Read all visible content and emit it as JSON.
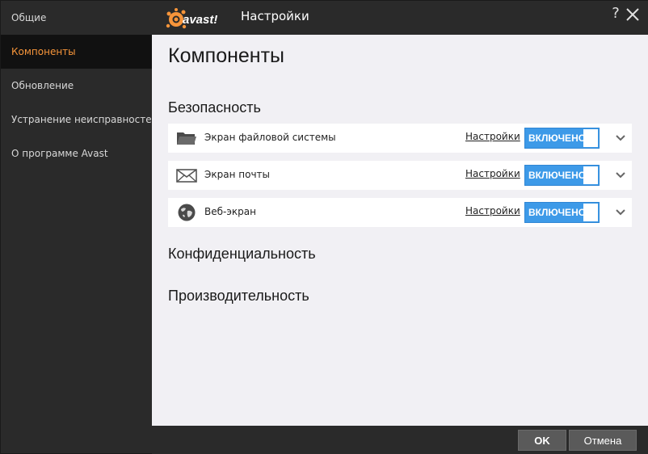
{
  "app": {
    "logo_text": "avast!",
    "title": "Настройки",
    "help_label": "?"
  },
  "sidebar": {
    "items": [
      {
        "label": "Общие",
        "active": false
      },
      {
        "label": "Компоненты",
        "active": true
      },
      {
        "label": "Обновление",
        "active": false
      },
      {
        "label": "Устранение неисправностей",
        "active": false
      },
      {
        "label": "О программе Avast",
        "active": false
      }
    ]
  },
  "main": {
    "page_title": "Компоненты",
    "sections": [
      {
        "heading": "Безопасность"
      },
      {
        "heading": "Конфиденциальность"
      },
      {
        "heading": "Производительность"
      }
    ],
    "components": [
      {
        "name": "Экран файловой системы",
        "icon": "folder-icon",
        "settings_label": "Настройки",
        "toggle_label": "ВКЛЮЧЕНО"
      },
      {
        "name": "Экран почты",
        "icon": "mail-icon",
        "settings_label": "Настройки",
        "toggle_label": "ВКЛЮЧЕНО"
      },
      {
        "name": "Веб-экран",
        "icon": "globe-icon",
        "settings_label": "Настройки",
        "toggle_label": "ВКЛЮЧЕНО"
      }
    ]
  },
  "footer": {
    "ok_label": "OK",
    "cancel_label": "Отмена"
  },
  "colors": {
    "accent": "#f7953a",
    "toggle_on": "#3d9ae8",
    "sidebar_bg": "#2a2a2a",
    "content_bg": "#f1f0f4"
  }
}
